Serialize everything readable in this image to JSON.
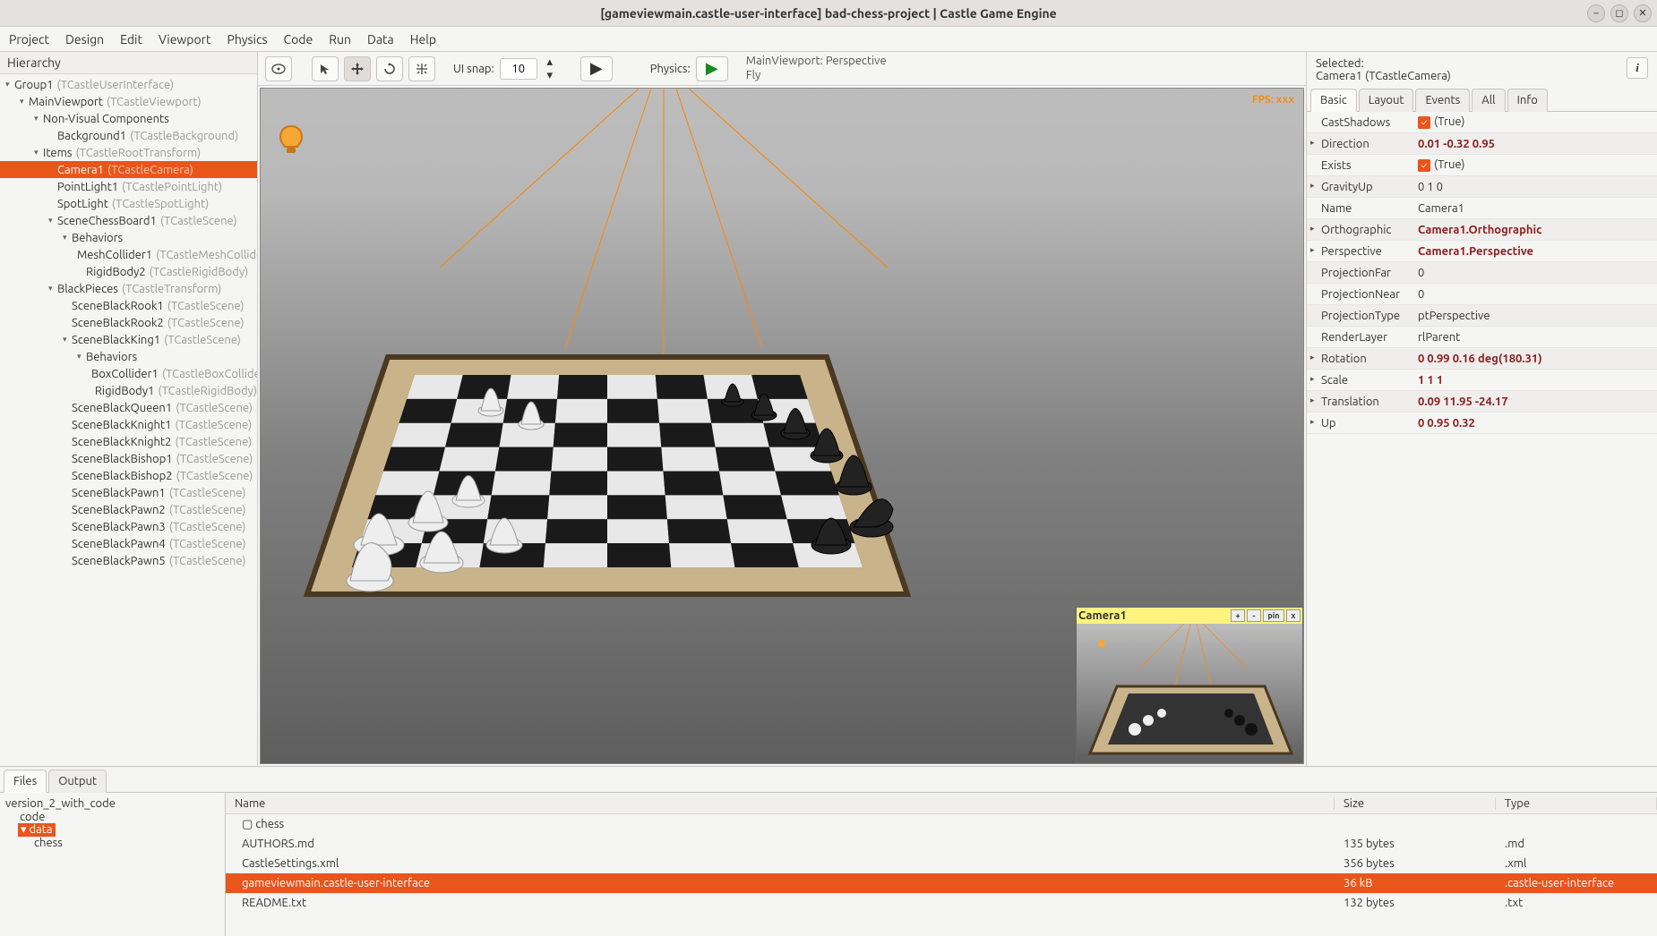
{
  "window": {
    "title": "[gameviewmain.castle-user-interface] bad-chess-project | Castle Game Engine"
  },
  "menubar": [
    "Project",
    "Design",
    "Edit",
    "Viewport",
    "Physics",
    "Code",
    "Run",
    "Data",
    "Help"
  ],
  "hierarchy": {
    "title": "Hierarchy",
    "items": [
      {
        "d": 0,
        "c": "▾",
        "n": "Group1",
        "t": "(TCastleUserInterface)"
      },
      {
        "d": 1,
        "c": "▾",
        "n": "MainViewport",
        "t": "(TCastleViewport)"
      },
      {
        "d": 2,
        "c": "▾",
        "n": "Non-Visual Components",
        "t": ""
      },
      {
        "d": 3,
        "c": "",
        "n": "Background1",
        "t": "(TCastleBackground)"
      },
      {
        "d": 2,
        "c": "▾",
        "n": "Items",
        "t": "(TCastleRootTransform)"
      },
      {
        "d": 3,
        "c": "",
        "n": "Camera1",
        "t": "(TCastleCamera)",
        "sel": true
      },
      {
        "d": 3,
        "c": "",
        "n": "PointLight1",
        "t": "(TCastlePointLight)"
      },
      {
        "d": 3,
        "c": "",
        "n": "SpotLight",
        "t": "(TCastleSpotLight)"
      },
      {
        "d": 3,
        "c": "▾",
        "n": "SceneChessBoard1",
        "t": "(TCastleScene)"
      },
      {
        "d": 4,
        "c": "▾",
        "n": "Behaviors",
        "t": ""
      },
      {
        "d": 5,
        "c": "",
        "n": "MeshCollider1",
        "t": "(TCastleMeshCollider)"
      },
      {
        "d": 5,
        "c": "",
        "n": "RigidBody2",
        "t": "(TCastleRigidBody)"
      },
      {
        "d": 3,
        "c": "▾",
        "n": "BlackPieces",
        "t": "(TCastleTransform)"
      },
      {
        "d": 4,
        "c": "",
        "n": "SceneBlackRook1",
        "t": "(TCastleScene)"
      },
      {
        "d": 4,
        "c": "",
        "n": "SceneBlackRook2",
        "t": "(TCastleScene)"
      },
      {
        "d": 4,
        "c": "▾",
        "n": "SceneBlackKing1",
        "t": "(TCastleScene)"
      },
      {
        "d": 5,
        "c": "▾",
        "n": "Behaviors",
        "t": ""
      },
      {
        "d": 6,
        "c": "",
        "n": "BoxCollider1",
        "t": "(TCastleBoxCollider)"
      },
      {
        "d": 6,
        "c": "",
        "n": "RigidBody1",
        "t": "(TCastleRigidBody)"
      },
      {
        "d": 4,
        "c": "",
        "n": "SceneBlackQueen1",
        "t": "(TCastleScene)"
      },
      {
        "d": 4,
        "c": "",
        "n": "SceneBlackKnight1",
        "t": "(TCastleScene)"
      },
      {
        "d": 4,
        "c": "",
        "n": "SceneBlackKnight2",
        "t": "(TCastleScene)"
      },
      {
        "d": 4,
        "c": "",
        "n": "SceneBlackBishop1",
        "t": "(TCastleScene)"
      },
      {
        "d": 4,
        "c": "",
        "n": "SceneBlackBishop2",
        "t": "(TCastleScene)"
      },
      {
        "d": 4,
        "c": "",
        "n": "SceneBlackPawn1",
        "t": "(TCastleScene)"
      },
      {
        "d": 4,
        "c": "",
        "n": "SceneBlackPawn2",
        "t": "(TCastleScene)"
      },
      {
        "d": 4,
        "c": "",
        "n": "SceneBlackPawn3",
        "t": "(TCastleScene)"
      },
      {
        "d": 4,
        "c": "",
        "n": "SceneBlackPawn4",
        "t": "(TCastleScene)"
      },
      {
        "d": 4,
        "c": "",
        "n": "SceneBlackPawn5",
        "t": "(TCastleScene)"
      }
    ]
  },
  "toolbar": {
    "ui_snap_label": "UI snap:",
    "ui_snap_value": "10",
    "physics_label": "Physics:",
    "status_line1": "MainViewport: Perspective",
    "status_line2": "Fly"
  },
  "viewport": {
    "fps": "FPS: xxx",
    "camera_preview_title": "Camera1",
    "preview_buttons": [
      "+",
      "-",
      "pin",
      "x"
    ]
  },
  "inspector": {
    "selected_label": "Selected:",
    "selected_name": "Camera1 (TCastleCamera)",
    "tabs": [
      "Basic",
      "Layout",
      "Events",
      "All",
      "Info"
    ],
    "props": [
      {
        "k": "CastShadows",
        "v": "(True)",
        "chk": true
      },
      {
        "k": "Direction",
        "v": "0.01 -0.32 0.95",
        "exp": "▸",
        "bold": true
      },
      {
        "k": "Exists",
        "v": "(True)",
        "chk": true
      },
      {
        "k": "GravityUp",
        "v": "0 1 0",
        "exp": "▸"
      },
      {
        "k": "Name",
        "v": "Camera1"
      },
      {
        "k": "Orthographic",
        "v": "Camera1.Orthographic",
        "exp": "▸",
        "bold": true
      },
      {
        "k": "Perspective",
        "v": "Camera1.Perspective",
        "exp": "▸",
        "bold": true
      },
      {
        "k": "ProjectionFar",
        "v": "0"
      },
      {
        "k": "ProjectionNear",
        "v": "0"
      },
      {
        "k": "ProjectionType",
        "v": "ptPerspective"
      },
      {
        "k": "RenderLayer",
        "v": "rlParent"
      },
      {
        "k": "Rotation",
        "v": "0 0.99 0.16 deg(180.31)",
        "exp": "▸",
        "bold": true
      },
      {
        "k": "Scale",
        "v": "1 1 1",
        "exp": "▸",
        "bold": true
      },
      {
        "k": "Translation",
        "v": "0.09 11.95 -24.17",
        "exp": "▸",
        "bold": true
      },
      {
        "k": "Up",
        "v": "0 0.95 0.32",
        "exp": "▸",
        "bold": true
      }
    ]
  },
  "bottom": {
    "tabs": [
      "Files",
      "Output"
    ],
    "tree_root": "version_2_with_code",
    "tree_items": [
      {
        "d": 1,
        "n": "code"
      },
      {
        "d": 1,
        "n": "data",
        "sel": true,
        "exp": true
      },
      {
        "d": 2,
        "n": "chess"
      }
    ],
    "cols": {
      "name": "Name",
      "size": "Size",
      "type": "Type"
    },
    "rows": [
      {
        "name": "chess",
        "size": "",
        "type": "",
        "folder": true
      },
      {
        "name": "AUTHORS.md",
        "size": "135 bytes",
        "type": ".md"
      },
      {
        "name": "CastleSettings.xml",
        "size": "356 bytes",
        "type": ".xml"
      },
      {
        "name": "gameviewmain.castle-user-interface",
        "size": "36 kB",
        "type": ".castle-user-interface",
        "sel": true
      },
      {
        "name": "README.txt",
        "size": "132 bytes",
        "type": ".txt"
      }
    ]
  }
}
